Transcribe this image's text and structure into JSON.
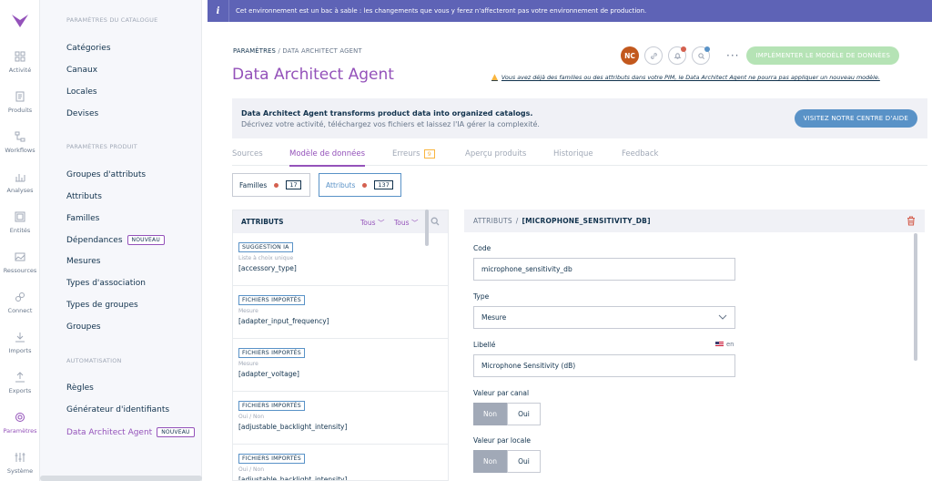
{
  "nav": {
    "items": [
      {
        "label": "Activité",
        "icon": "dashboard-icon"
      },
      {
        "label": "Produits",
        "icon": "product-icon"
      },
      {
        "label": "Workflows",
        "icon": "workflow-icon"
      },
      {
        "label": "Analyses",
        "icon": "chart-icon"
      },
      {
        "label": "Entités",
        "icon": "entity-icon"
      },
      {
        "label": "Ressources",
        "icon": "image-icon"
      },
      {
        "label": "Connect",
        "icon": "link-icon"
      },
      {
        "label": "Imports",
        "icon": "import-icon"
      },
      {
        "label": "Exports",
        "icon": "export-icon"
      },
      {
        "label": "Paramètres",
        "icon": "gear-icon"
      },
      {
        "label": "Système",
        "icon": "sliders-icon"
      }
    ],
    "active_index": 9,
    "accent": "#9452ba"
  },
  "panel": {
    "catalog_title": "PARAMÈTRES DU CATALOGUE",
    "catalog_items": [
      "Catégories",
      "Canaux",
      "Locales",
      "Devises"
    ],
    "product_title": "PARAMÈTRES PRODUIT",
    "product_items": [
      "Groupes d'attributs",
      "Attributs",
      "Familles",
      "Dépendances",
      "Mesures",
      "Types d'association",
      "Types de groupes",
      "Groupes"
    ],
    "new_tag": "NOUVEAU",
    "automation_title": "AUTOMATISATION",
    "automation_items": [
      "Règles",
      "Générateur d'identifiants",
      "Data Architect Agent"
    ]
  },
  "banner": {
    "icon": "i",
    "text": "Cet environnement est un bac à sable : les changements que vous y ferez n'affecteront pas votre environnement de production."
  },
  "header": {
    "breadcrumb_parent": "PARAMÈTRES",
    "breadcrumb_sep": "/",
    "breadcrumb_current": "DATA ARCHITECT AGENT",
    "title": "Data Architect Agent",
    "avatar": "NC",
    "more": "···",
    "primary_button": "IMPLÉMENTER LE MODÈLE DE DONNÉES",
    "warning": "Vous avez déjà des familles ou des attributs dans votre PIM, le Data Architect Agent ne pourra pas appliquer un nouveau modèle."
  },
  "help": {
    "title": "Data Architect Agent transforms product data into organized catalogs.",
    "subtitle": "Décrivez votre activité, téléchargez vos fichiers et laissez l'IA gérer la complexité.",
    "button": "VISITEZ NOTRE CENTRE D'AIDE"
  },
  "tabs": [
    {
      "label": "Sources"
    },
    {
      "label": "Modèle de données"
    },
    {
      "label": "Erreurs",
      "count": "9"
    },
    {
      "label": "Aperçu produits"
    },
    {
      "label": "Historique"
    },
    {
      "label": "Feedback"
    }
  ],
  "chips": [
    {
      "label": "Familles",
      "count": "17"
    },
    {
      "label": "Attributs",
      "count": "137"
    }
  ],
  "list": {
    "title": "ATTRIBUTS",
    "filter1": "Tous",
    "filter2": "Tous",
    "rows": [
      {
        "badge": "SUGGESTION IA",
        "type": "Liste à choix unique",
        "code": "[accessory_type]"
      },
      {
        "badge": "FICHIERS IMPORTÉS",
        "type": "Mesure",
        "code": "[adapter_input_frequency]"
      },
      {
        "badge": "FICHIERS IMPORTÉS",
        "type": "Mesure",
        "code": "[adapter_voltage]"
      },
      {
        "badge": "FICHIERS IMPORTÉS",
        "type": "Oui / Non",
        "code": "[adjustable_backlight_intensity]"
      },
      {
        "badge": "FICHIERS IMPORTÉS",
        "type": "Oui / Non",
        "code": "[adjustable_backlight_intensity]"
      }
    ]
  },
  "detail": {
    "breadcrumb_parent": "ATTRIBUTS",
    "breadcrumb_sep": "/",
    "breadcrumb_current": "[MICROPHONE_SENSITIVITY_DB]",
    "code_label": "Code",
    "code_value": "microphone_sensitivity_db",
    "type_label": "Type",
    "type_value": "Mesure",
    "label_label": "Libellé",
    "locale": "en",
    "label_value": "Microphone Sensitivity (dB)",
    "per_channel_label": "Valeur par canal",
    "per_locale_label": "Valeur par locale",
    "no": "Non",
    "yes": "Oui"
  }
}
